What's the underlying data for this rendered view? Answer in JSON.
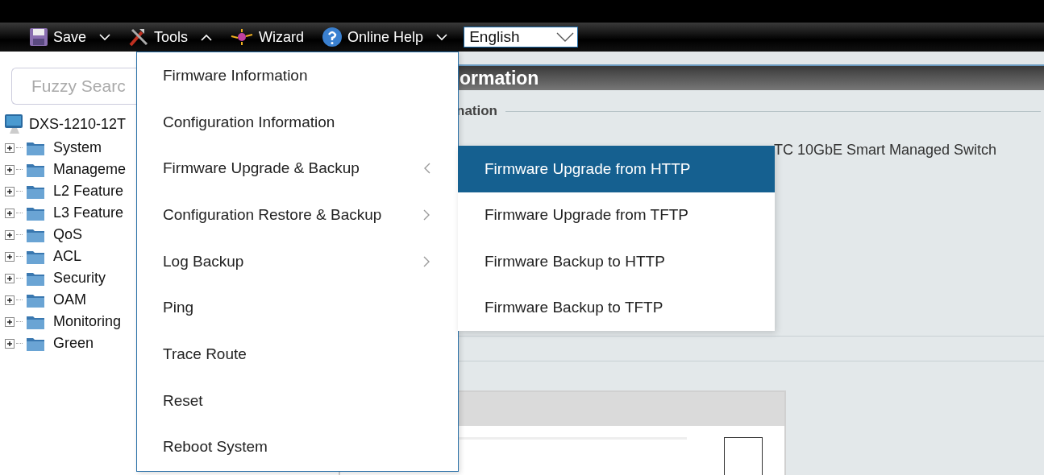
{
  "toolbar": {
    "items": [
      {
        "kind": "dropdown",
        "label": "Save",
        "expanded": false
      },
      {
        "kind": "dropdown",
        "label": "Tools",
        "expanded": true
      },
      {
        "kind": "button",
        "label": "Wizard"
      },
      {
        "kind": "dropdown",
        "label": "Online Help",
        "expanded": false
      }
    ],
    "language": {
      "value": "English"
    }
  },
  "sidebar": {
    "search": {
      "placeholder": "Fuzzy Searc"
    },
    "device": "DXS-1210-12T",
    "items": [
      {
        "label": "System",
        "expanded": false
      },
      {
        "label": "Manageme",
        "expanded": false
      },
      {
        "label": "L2 Feature",
        "expanded": false
      },
      {
        "label": "L3 Feature",
        "expanded": false
      },
      {
        "label": "QoS",
        "expanded": false
      },
      {
        "label": "ACL",
        "expanded": false
      },
      {
        "label": "Security",
        "expanded": false
      },
      {
        "label": "OAM",
        "expanded": false
      },
      {
        "label": "Monitoring",
        "expanded": false
      },
      {
        "label": "Green",
        "expanded": false
      }
    ]
  },
  "tools_menu": {
    "items": [
      {
        "kind": "item",
        "label": "Firmware Information"
      },
      {
        "kind": "item",
        "label": "Configuration Information"
      },
      {
        "kind": "submenu",
        "label": "Firmware Upgrade & Backup",
        "expanded": true
      },
      {
        "kind": "submenu",
        "label": "Configuration Restore & Backup",
        "expanded": false
      },
      {
        "kind": "submenu",
        "label": "Log Backup",
        "expanded": false
      },
      {
        "kind": "item",
        "label": "Ping"
      },
      {
        "kind": "item",
        "label": "Trace Route"
      },
      {
        "kind": "item",
        "label": "Reset"
      },
      {
        "kind": "item",
        "label": "Reboot System"
      }
    ],
    "submenu": [
      {
        "label": "Firmware Upgrade from HTTP",
        "selected": true
      },
      {
        "label": "Firmware Upgrade from TFTP",
        "selected": false
      },
      {
        "label": "Firmware Backup to HTTP",
        "selected": false
      },
      {
        "label": "Firmware Backup to TFTP",
        "selected": false
      }
    ]
  },
  "panel": {
    "title": "ormation",
    "section": "nation",
    "description": "TC 10GbE Smart Managed Switch",
    "checkbox": {
      "checked": false
    }
  }
}
